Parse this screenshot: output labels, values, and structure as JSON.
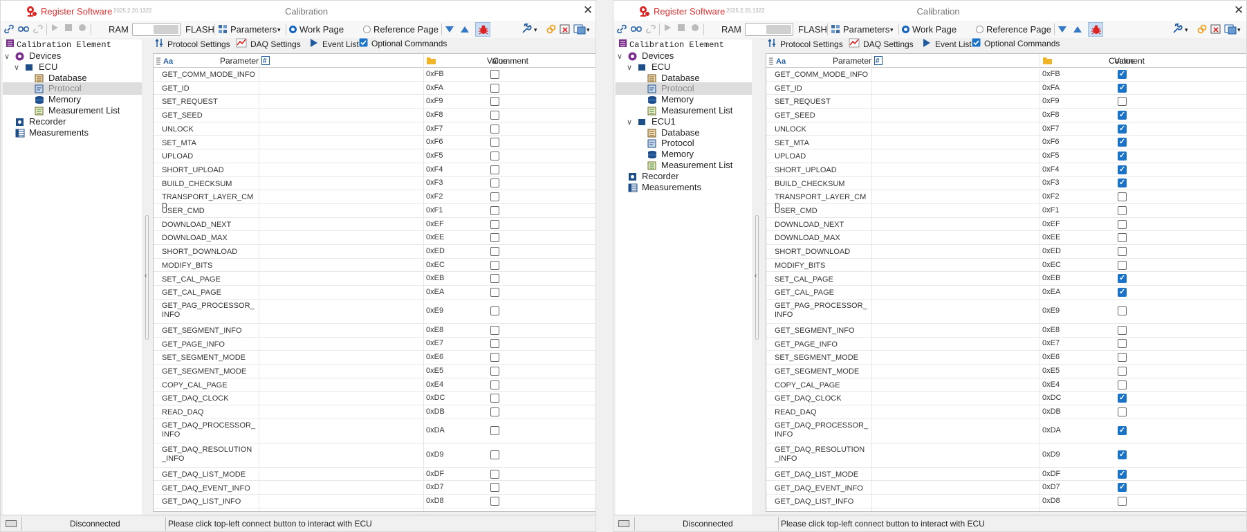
{
  "app": {
    "name": "Register Software",
    "version": "2025.2.20.1322",
    "window_title": "Calibration",
    "close": "✕"
  },
  "toolbar": {
    "ram": "RAM",
    "flash": "FLASH",
    "parameters": "Parameters",
    "work_page": "Work Page",
    "reference_page": "Reference Page",
    "page_selected": "Work Page"
  },
  "tree": {
    "title": "Calibration Element",
    "devices": "Devices",
    "ecu": "ECU",
    "ecu1": "ECU1",
    "database": "Database",
    "protocol": "Protocol",
    "memory": "Memory",
    "measurement_list": "Measurement List",
    "recorder": "Recorder",
    "measurements": "Measurements"
  },
  "tabs": {
    "protocol": "Protocol Settings",
    "daq": "DAQ Settings",
    "event": "Event List",
    "optional": "Optional Commands"
  },
  "table": {
    "h_aa": "Aa",
    "h_parameter": "Parameter",
    "h_hash": "#",
    "h_value": "Value",
    "h_comment": "Comment"
  },
  "status": {
    "state": "Disconnected",
    "message": "Please click top-left connect button to interact with ECU"
  },
  "rows_left": [
    {
      "p": "GET_COMM_MODE_INFO",
      "c": "0xFB",
      "v": false
    },
    {
      "p": "GET_ID",
      "c": "0xFA",
      "v": false
    },
    {
      "p": "SET_REQUEST",
      "c": "0xF9",
      "v": false
    },
    {
      "p": "GET_SEED",
      "c": "0xF8",
      "v": false
    },
    {
      "p": "UNLOCK",
      "c": "0xF7",
      "v": false
    },
    {
      "p": "SET_MTA",
      "c": "0xF6",
      "v": false
    },
    {
      "p": "UPLOAD",
      "c": "0xF5",
      "v": false
    },
    {
      "p": "SHORT_UPLOAD",
      "c": "0xF4",
      "v": false
    },
    {
      "p": "BUILD_CHECKSUM",
      "c": "0xF3",
      "v": false
    },
    {
      "p": "TRANSPORT_LAYER_CMD",
      "c": "0xF2",
      "v": false
    },
    {
      "p": "USER_CMD",
      "c": "0xF1",
      "v": false
    },
    {
      "p": "DOWNLOAD_NEXT",
      "c": "0xEF",
      "v": false
    },
    {
      "p": "DOWNLOAD_MAX",
      "c": "0xEE",
      "v": false
    },
    {
      "p": "SHORT_DOWNLOAD",
      "c": "0xED",
      "v": false
    },
    {
      "p": "MODIFY_BITS",
      "c": "0xEC",
      "v": false
    },
    {
      "p": "SET_CAL_PAGE",
      "c": "0xEB",
      "v": false
    },
    {
      "p": "GET_CAL_PAGE",
      "c": "0xEA",
      "v": false
    },
    {
      "p": "GET_PAG_PROCESSOR_INFO",
      "c": "0xE9",
      "v": false
    },
    {
      "p": "GET_SEGMENT_INFO",
      "c": "0xE8",
      "v": false
    },
    {
      "p": "GET_PAGE_INFO",
      "c": "0xE7",
      "v": false
    },
    {
      "p": "SET_SEGMENT_MODE",
      "c": "0xE6",
      "v": false
    },
    {
      "p": "GET_SEGMENT_MODE",
      "c": "0xE5",
      "v": false
    },
    {
      "p": "COPY_CAL_PAGE",
      "c": "0xE4",
      "v": false
    },
    {
      "p": "GET_DAQ_CLOCK",
      "c": "0xDC",
      "v": false
    },
    {
      "p": "READ_DAQ",
      "c": "0xDB",
      "v": false
    },
    {
      "p": "GET_DAQ_PROCESSOR_INFO",
      "c": "0xDA",
      "v": false
    },
    {
      "p": "GET_DAQ_RESOLUTION_INFO",
      "c": "0xD9",
      "v": false
    },
    {
      "p": "GET_DAQ_LIST_MODE",
      "c": "0xDF",
      "v": false
    },
    {
      "p": "GET_DAQ_EVENT_INFO",
      "c": "0xD7",
      "v": false
    },
    {
      "p": "GET_DAQ_LIST_INFO",
      "c": "0xD8",
      "v": false
    }
  ],
  "rows_right": [
    {
      "p": "GET_COMM_MODE_INFO",
      "c": "0xFB",
      "v": true
    },
    {
      "p": "GET_ID",
      "c": "0xFA",
      "v": true
    },
    {
      "p": "SET_REQUEST",
      "c": "0xF9",
      "v": false
    },
    {
      "p": "GET_SEED",
      "c": "0xF8",
      "v": true
    },
    {
      "p": "UNLOCK",
      "c": "0xF7",
      "v": true
    },
    {
      "p": "SET_MTA",
      "c": "0xF6",
      "v": true
    },
    {
      "p": "UPLOAD",
      "c": "0xF5",
      "v": true
    },
    {
      "p": "SHORT_UPLOAD",
      "c": "0xF4",
      "v": true
    },
    {
      "p": "BUILD_CHECKSUM",
      "c": "0xF3",
      "v": true
    },
    {
      "p": "TRANSPORT_LAYER_CMD",
      "c": "0xF2",
      "v": false
    },
    {
      "p": "USER_CMD",
      "c": "0xF1",
      "v": false
    },
    {
      "p": "DOWNLOAD_NEXT",
      "c": "0xEF",
      "v": false
    },
    {
      "p": "DOWNLOAD_MAX",
      "c": "0xEE",
      "v": false
    },
    {
      "p": "SHORT_DOWNLOAD",
      "c": "0xED",
      "v": false
    },
    {
      "p": "MODIFY_BITS",
      "c": "0xEC",
      "v": false
    },
    {
      "p": "SET_CAL_PAGE",
      "c": "0xEB",
      "v": true
    },
    {
      "p": "GET_CAL_PAGE",
      "c": "0xEA",
      "v": true
    },
    {
      "p": "GET_PAG_PROCESSOR_INFO",
      "c": "0xE9",
      "v": false
    },
    {
      "p": "GET_SEGMENT_INFO",
      "c": "0xE8",
      "v": false
    },
    {
      "p": "GET_PAGE_INFO",
      "c": "0xE7",
      "v": false
    },
    {
      "p": "SET_SEGMENT_MODE",
      "c": "0xE6",
      "v": false
    },
    {
      "p": "GET_SEGMENT_MODE",
      "c": "0xE5",
      "v": false
    },
    {
      "p": "COPY_CAL_PAGE",
      "c": "0xE4",
      "v": false
    },
    {
      "p": "GET_DAQ_CLOCK",
      "c": "0xDC",
      "v": true
    },
    {
      "p": "READ_DAQ",
      "c": "0xDB",
      "v": false
    },
    {
      "p": "GET_DAQ_PROCESSOR_INFO",
      "c": "0xDA",
      "v": true
    },
    {
      "p": "GET_DAQ_RESOLUTION_INFO",
      "c": "0xD9",
      "v": true
    },
    {
      "p": "GET_DAQ_LIST_MODE",
      "c": "0xDF",
      "v": true
    },
    {
      "p": "GET_DAQ_EVENT_INFO",
      "c": "0xD7",
      "v": true
    },
    {
      "p": "GET_DAQ_LIST_INFO",
      "c": "0xD8",
      "v": false
    }
  ]
}
